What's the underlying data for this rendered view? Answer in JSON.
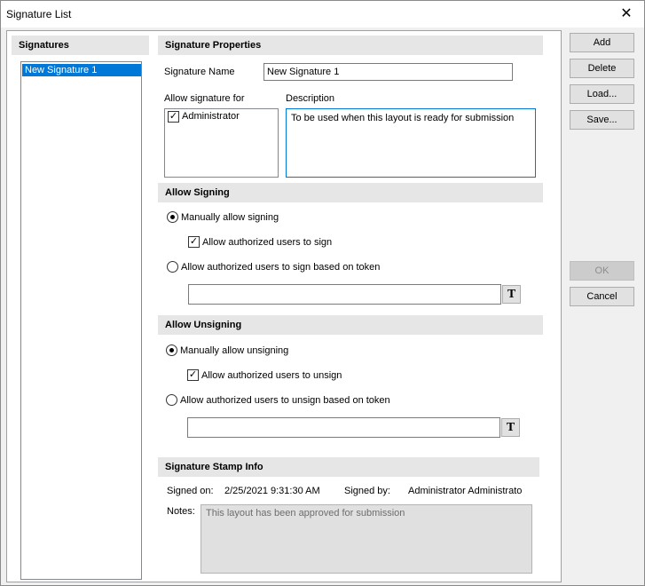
{
  "window": {
    "title": "Signature List",
    "close_icon": "close-icon"
  },
  "signatures": {
    "header": "Signatures",
    "items": [
      "New Signature 1"
    ]
  },
  "properties": {
    "header": "Signature Properties",
    "name_label": "Signature Name",
    "name_value": "New Signature 1",
    "allow_for_label": "Allow signature for",
    "allow_for_items": [
      {
        "label": "Administrator",
        "checked": true
      }
    ],
    "description_label": "Description",
    "description_value": "To be used when this layout is ready for submission"
  },
  "signing": {
    "header": "Allow Signing",
    "manual_label": "Manually allow signing",
    "manual_selected": true,
    "authorized_label": "Allow authorized users to sign",
    "authorized_checked": true,
    "token_label": "Allow authorized users to sign based on token",
    "token_selected": false,
    "token_value": "",
    "token_button": "T"
  },
  "unsigning": {
    "header": "Allow Unsigning",
    "manual_label": "Manually allow unsigning",
    "manual_selected": true,
    "authorized_label": "Allow authorized users to unsign",
    "authorized_checked": true,
    "token_label": "Allow authorized users to unsign based on token",
    "token_selected": false,
    "token_value": "",
    "token_button": "T"
  },
  "stamp": {
    "header": "Signature Stamp Info",
    "signed_on_label": "Signed on:",
    "signed_on_value": "2/25/2021 9:31:30 AM",
    "signed_by_label": "Signed by:",
    "signed_by_value": "Administrator Administrato",
    "notes_label": "Notes:",
    "notes_value": "This layout has been approved for submission"
  },
  "buttons": {
    "add": "Add",
    "delete": "Delete",
    "load": "Load...",
    "save": "Save...",
    "ok": "OK",
    "cancel": "Cancel"
  },
  "colors": {
    "selection": "#0078d7",
    "section_bg": "#e6e6e6",
    "dialog_bg": "#f0f0f0"
  }
}
